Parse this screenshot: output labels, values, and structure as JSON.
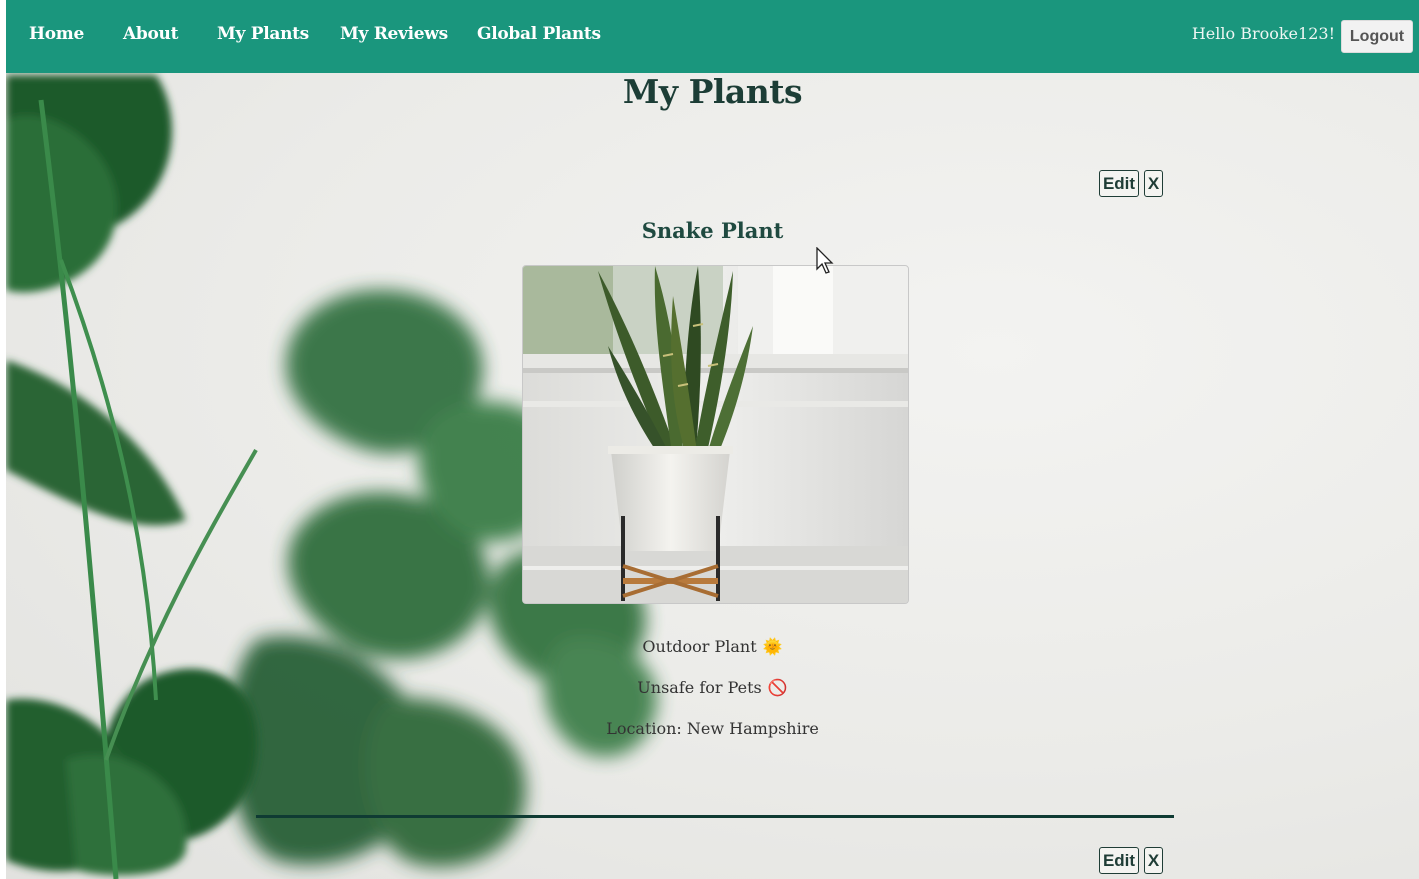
{
  "nav": {
    "items": [
      {
        "label": "Home"
      },
      {
        "label": "About"
      },
      {
        "label": "My Plants"
      },
      {
        "label": "My Reviews"
      },
      {
        "label": "Global Plants"
      }
    ],
    "greeting": "Hello Brooke123!",
    "logout_label": "Logout"
  },
  "page": {
    "title": "My Plants"
  },
  "plants": [
    {
      "name": "Snake Plant",
      "edit_label": "Edit",
      "delete_label": "X",
      "outdoor_text": "Outdoor Plant",
      "outdoor_icon": "🌞",
      "pet_text": "Unsafe for Pets",
      "pet_icon": "🚫",
      "location_text": "Location: New Hampshire"
    },
    {
      "edit_label": "Edit",
      "delete_label": "X"
    }
  ],
  "colors": {
    "navbar": "#1a967d",
    "heading": "#1c3d36",
    "divider": "#0f3b33"
  },
  "icons": {
    "outdoor": "sun-icon",
    "pet_safety": "prohibited-icon"
  }
}
